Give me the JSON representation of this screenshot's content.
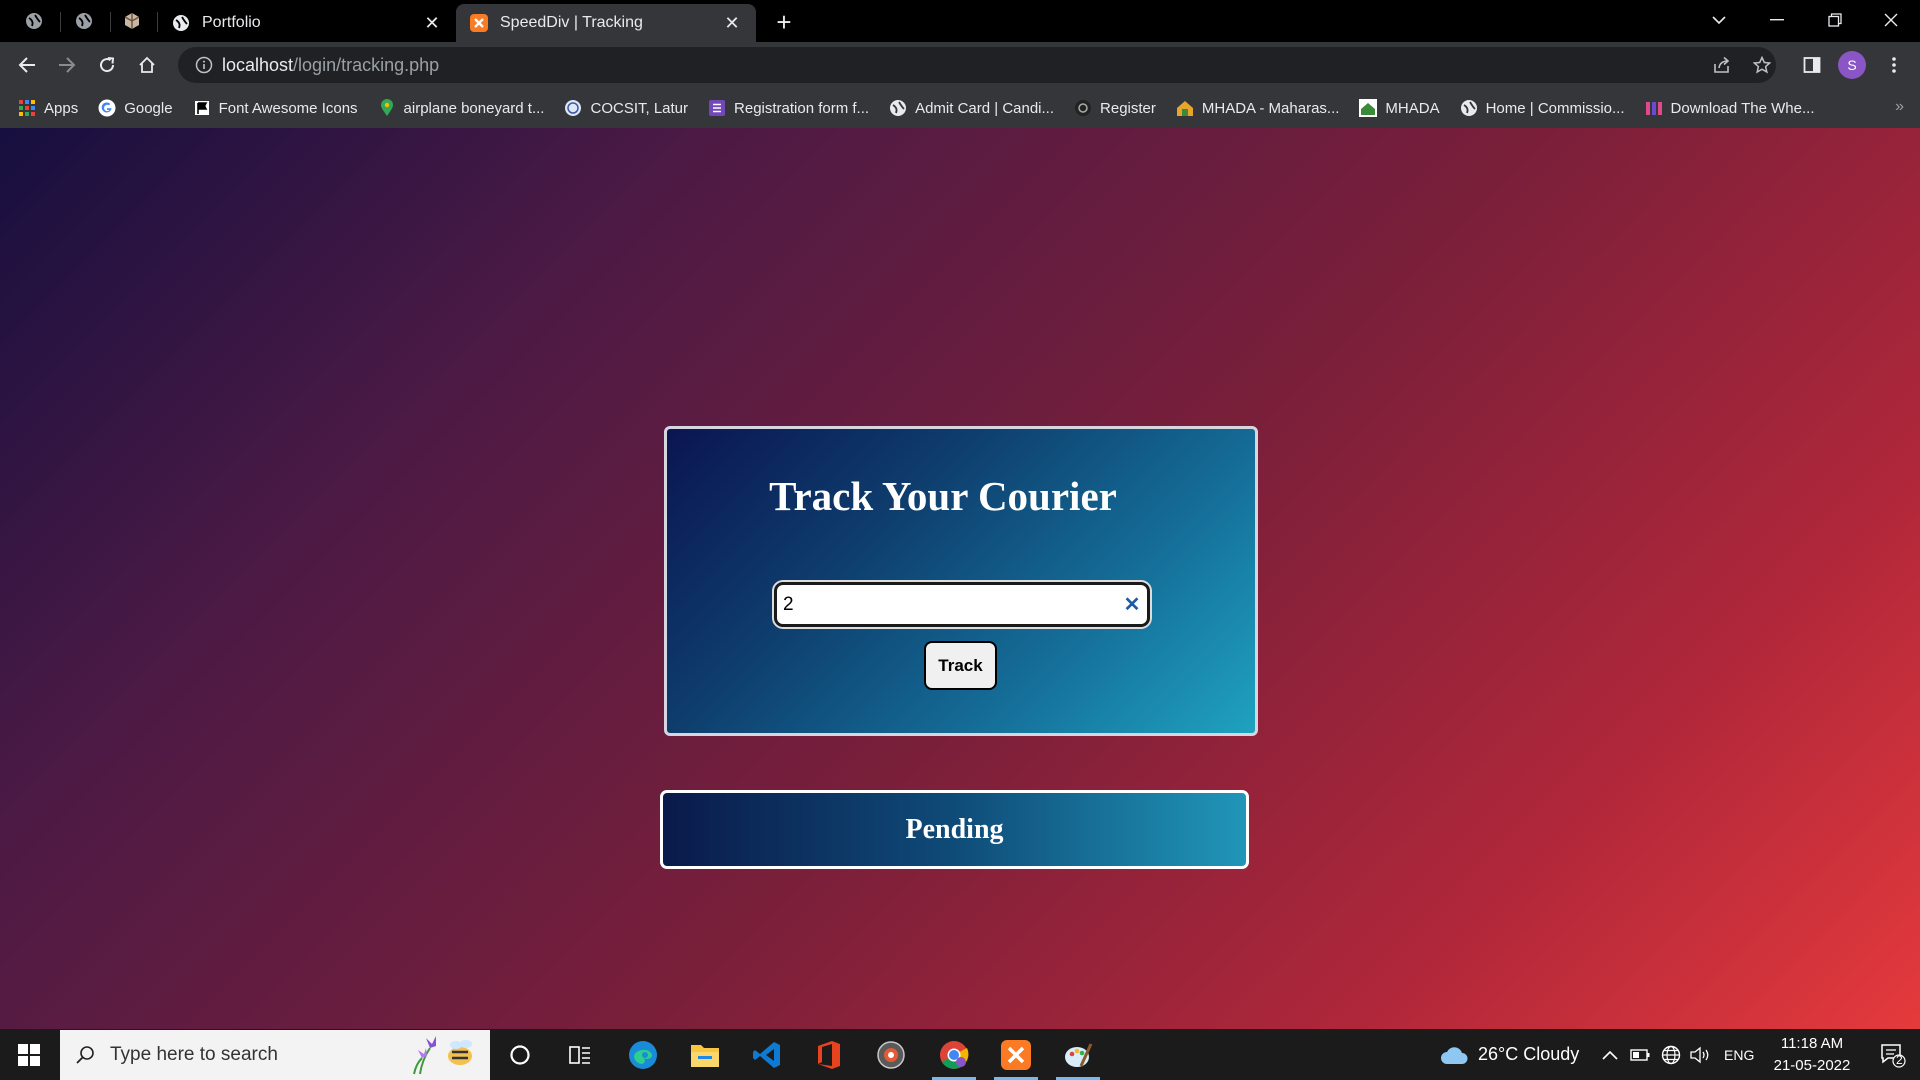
{
  "browser": {
    "tabs": [
      {
        "title": "Portfolio",
        "active": false
      },
      {
        "title": "SpeedDiv | Tracking",
        "active": true
      }
    ],
    "url_host": "localhost",
    "url_path": "/login/tracking.php",
    "profile_initial": "S",
    "bookmarks": [
      {
        "label": "Apps",
        "icon": "apps-grid-icon"
      },
      {
        "label": "Google",
        "icon": "google-icon"
      },
      {
        "label": "Font Awesome Icons",
        "icon": "flag-icon"
      },
      {
        "label": "airplane boneyard t...",
        "icon": "map-pin-icon"
      },
      {
        "label": "COCSIT, Latur",
        "icon": "college-icon"
      },
      {
        "label": "Registration form f...",
        "icon": "form-icon"
      },
      {
        "label": "Admit Card | Candi...",
        "icon": "globe-icon"
      },
      {
        "label": "Register",
        "icon": "register-icon"
      },
      {
        "label": "MHADA - Maharas...",
        "icon": "mhada-icon"
      },
      {
        "label": "MHADA",
        "icon": "mhada-icon"
      },
      {
        "label": "Home | Commissio...",
        "icon": "globe-icon"
      },
      {
        "label": "Download The Whe...",
        "icon": "download-site-icon"
      }
    ]
  },
  "page": {
    "heading": "Track Your Courier",
    "tracking_input_value": "2",
    "track_button_label": "Track",
    "status": "Pending"
  },
  "taskbar": {
    "search_placeholder": "Type here to search",
    "weather": "26°C  Cloudy",
    "language": "ENG",
    "time": "11:18 AM",
    "date": "21-05-2022",
    "notification_count": "2"
  }
}
